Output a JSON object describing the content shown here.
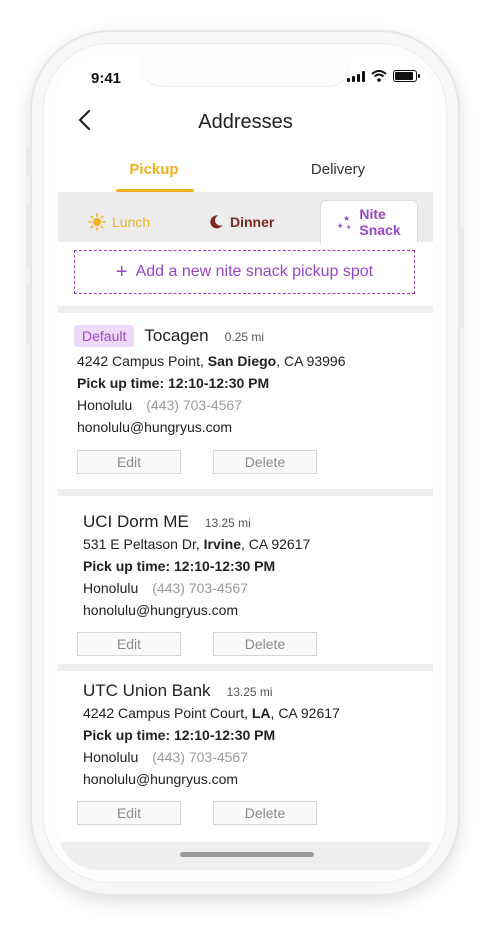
{
  "status_bar": {
    "time": "9:41"
  },
  "header": {
    "title": "Addresses"
  },
  "tabs": [
    {
      "label": "Pickup",
      "active": true
    },
    {
      "label": "Delivery",
      "active": false
    }
  ],
  "meal_tabs": [
    {
      "label": "Lunch",
      "icon": "sun-icon",
      "color": "#f2b021"
    },
    {
      "label": "Dinner",
      "icon": "moon-icon",
      "color": "#7b2a22"
    },
    {
      "label_line1": "Nite",
      "label_line2": "Snack",
      "icon": "stars-icon",
      "color": "#9b44c8",
      "active": true
    }
  ],
  "add_spot": {
    "label": "Add a new nite snack pickup spot"
  },
  "addresses": [
    {
      "badge": "Default",
      "name": "Tocagen",
      "distance": "0.25 mi",
      "street": "4242 Campus Point, ",
      "city": "San Diego",
      "state_zip": ", CA 93996",
      "pickup_label": "Pick up time: 12:10-12:30 PM",
      "contact_name": "Honolulu",
      "phone": "(443) 703-4567",
      "email": "honolulu@hungryus.com",
      "edit_label": "Edit",
      "delete_label": "Delete"
    },
    {
      "name": "UCI Dorm ME",
      "distance": "13.25 mi",
      "street": "531 E Peltason Dr, ",
      "city": "Irvine",
      "state_zip": ", CA 92617",
      "pickup_label": "Pick up time: 12:10-12:30 PM",
      "contact_name": "Honolulu",
      "phone": "(443) 703-4567",
      "email": "honolulu@hungryus.com",
      "edit_label": "Edit",
      "delete_label": "Delete"
    },
    {
      "name": "UTC Union Bank",
      "distance": "13.25 mi",
      "street": "4242 Campus Point Court, ",
      "city": "LA",
      "state_zip": ", CA 92617",
      "pickup_label": "Pick up time: 12:10-12:30 PM",
      "contact_name": "Honolulu",
      "phone": "(443) 703-4567",
      "email": "honolulu@hungryus.com",
      "edit_label": "Edit",
      "delete_label": "Delete"
    }
  ],
  "colors": {
    "accent_yellow": "#f2b021",
    "accent_purple": "#9b44c8",
    "dinner": "#7b2a22"
  }
}
